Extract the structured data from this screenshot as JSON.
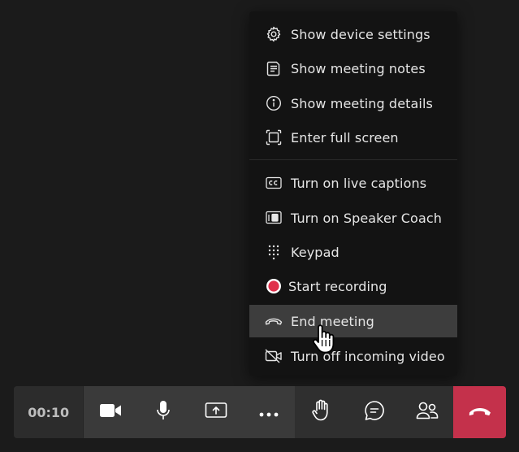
{
  "menu": {
    "items": [
      {
        "id": "device-settings",
        "label": "Show device settings",
        "icon": "gear-icon"
      },
      {
        "id": "meeting-notes",
        "label": "Show meeting notes",
        "icon": "notes-icon"
      },
      {
        "id": "meeting-details",
        "label": "Show meeting details",
        "icon": "info-icon"
      },
      {
        "id": "full-screen",
        "label": "Enter full screen",
        "icon": "fullscreen-icon"
      },
      {
        "id": "live-captions",
        "label": "Turn on live captions",
        "icon": "captions-icon"
      },
      {
        "id": "speaker-coach",
        "label": "Turn on Speaker Coach",
        "icon": "speaker-coach-icon"
      },
      {
        "id": "keypad",
        "label": "Keypad",
        "icon": "keypad-icon"
      },
      {
        "id": "start-recording",
        "label": "Start recording",
        "icon": "record-icon"
      },
      {
        "id": "end-meeting",
        "label": "End meeting",
        "icon": "phone-hangup-icon",
        "highlighted": true
      },
      {
        "id": "incoming-video",
        "label": "Turn off incoming video",
        "icon": "video-off-icon"
      }
    ]
  },
  "toolbar": {
    "timer": "00:10",
    "buttons": [
      {
        "id": "camera",
        "icon": "camera-icon"
      },
      {
        "id": "mic",
        "icon": "microphone-icon"
      },
      {
        "id": "share",
        "icon": "share-screen-icon"
      },
      {
        "id": "more",
        "icon": "more-icon"
      },
      {
        "id": "raise-hand",
        "icon": "raise-hand-icon"
      },
      {
        "id": "chat",
        "icon": "chat-icon"
      },
      {
        "id": "people",
        "icon": "people-icon"
      },
      {
        "id": "leave",
        "icon": "phone-hangup-icon"
      }
    ]
  },
  "colors": {
    "background": "#1b1b1b",
    "menu_background": "#131313",
    "menu_highlight": "#3d3d3d",
    "text": "#e6e6e6",
    "record_red": "#e0314b",
    "leave_red": "#c4314b"
  }
}
